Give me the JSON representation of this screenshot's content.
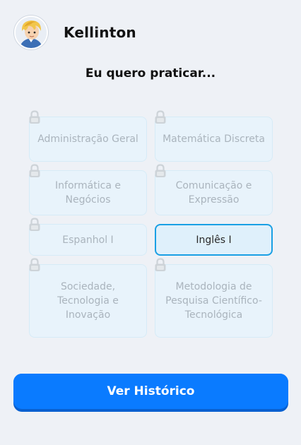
{
  "user": {
    "name": "Kellinton",
    "avatar_icon": "anime-avatar"
  },
  "prompt": "Eu quero praticar...",
  "subjects": [
    {
      "label": "Administração Geral",
      "locked": true
    },
    {
      "label": "Matemática Discreta",
      "locked": true
    },
    {
      "label": "Informática e Negócios",
      "locked": true
    },
    {
      "label": "Comunicação e Expressão",
      "locked": true
    },
    {
      "label": "Espanhol I",
      "locked": true
    },
    {
      "label": "Inglês I",
      "locked": false,
      "selected": true
    },
    {
      "label": "Sociedade, Tecnologia e Inovação",
      "locked": true
    },
    {
      "label": "Metodologia de Pesquisa Científico-Tecnológica",
      "locked": true
    }
  ],
  "history_button": "Ver Histórico",
  "colors": {
    "background": "#eef1f6",
    "card_bg": "#e8f3fb",
    "card_border": "#d6ebf7",
    "active_border": "#1aa0e4",
    "locked_text": "#aab4bd",
    "primary": "#0a7bff"
  }
}
